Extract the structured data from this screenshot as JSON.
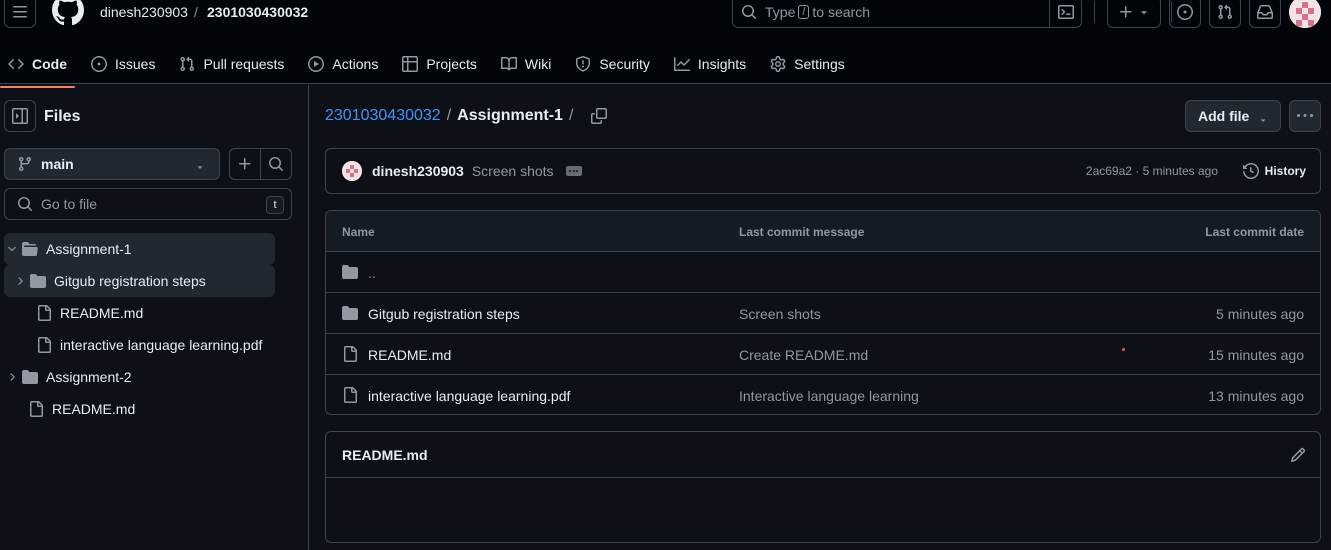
{
  "header": {
    "owner": "dinesh230903",
    "separator": "/",
    "repo": "2301030430032",
    "search_prefix": "Type",
    "search_key": "/",
    "search_suffix": "to search"
  },
  "tabs": [
    {
      "label": "Code",
      "icon": "code-icon",
      "active": true
    },
    {
      "label": "Issues",
      "icon": "issue-icon"
    },
    {
      "label": "Pull requests",
      "icon": "pull-request-icon"
    },
    {
      "label": "Actions",
      "icon": "play-icon"
    },
    {
      "label": "Projects",
      "icon": "table-icon"
    },
    {
      "label": "Wiki",
      "icon": "book-icon"
    },
    {
      "label": "Security",
      "icon": "shield-icon"
    },
    {
      "label": "Insights",
      "icon": "graph-icon"
    },
    {
      "label": "Settings",
      "icon": "gear-icon"
    }
  ],
  "sidebar": {
    "title": "Files",
    "branch": "main",
    "goto_placeholder": "Go to file",
    "goto_key": "t",
    "tree": [
      {
        "label": "Assignment-1",
        "type": "folder",
        "expanded": true,
        "depth": 0,
        "selected": true
      },
      {
        "label": "Gitgub registration steps",
        "type": "folder",
        "expanded": false,
        "depth": 1,
        "selected": true
      },
      {
        "label": "README.md",
        "type": "file",
        "depth": 1
      },
      {
        "label": "interactive language learning.pdf",
        "type": "file",
        "depth": 1
      },
      {
        "label": "Assignment-2",
        "type": "folder",
        "expanded": false,
        "depth": 0
      },
      {
        "label": "README.md",
        "type": "file",
        "depth": 0
      }
    ]
  },
  "breadcrumb": {
    "root": "2301030430032",
    "sep": "/",
    "current": "Assignment-1",
    "trail": "/"
  },
  "actions": {
    "add_file": "Add file"
  },
  "commit": {
    "author": "dinesh230903",
    "message": "Screen shots",
    "meta": "2ac69a2 · 5 minutes ago",
    "history": "History"
  },
  "table": {
    "headers": {
      "name": "Name",
      "message": "Last commit message",
      "date": "Last commit date"
    },
    "parent": "..",
    "rows": [
      {
        "name": "Gitgub registration steps",
        "type": "folder",
        "message": "Screen shots",
        "date": "5 minutes ago"
      },
      {
        "name": "README.md",
        "type": "file",
        "message": "Create README.md",
        "date": "15 minutes ago"
      },
      {
        "name": "interactive language learning.pdf",
        "type": "file",
        "message": "Interactive language learning",
        "date": "13 minutes ago"
      }
    ]
  },
  "readme": {
    "title": "README.md"
  },
  "colors": {
    "bg": "#0d1117",
    "header_bg": "#010409",
    "border": "#3d444d",
    "link": "#4493f8",
    "active_tab": "#f78166"
  }
}
